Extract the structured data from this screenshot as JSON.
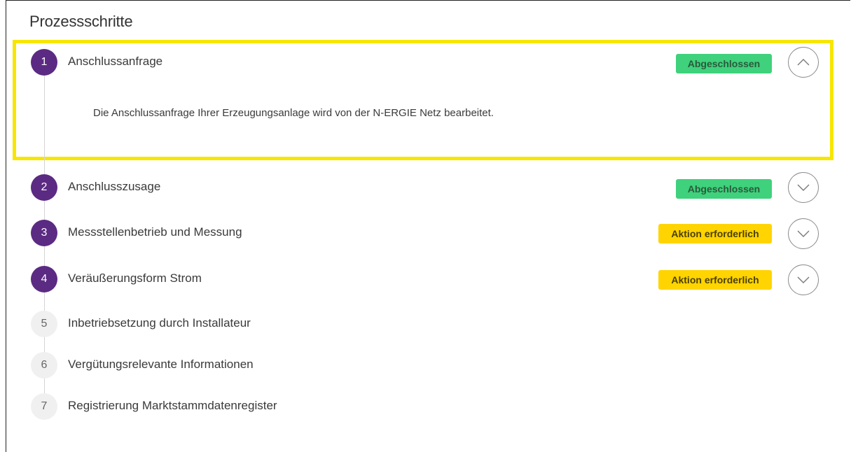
{
  "section": {
    "title": "Prozessschritte"
  },
  "steps": [
    {
      "number": "1",
      "label": "Anschlussanfrage",
      "status": "Abgeschlossen",
      "expanded": true,
      "description": "Die Anschlussanfrage Ihrer Erzeugungsanlage wird von der N-ERGIE Netz bearbeitet."
    },
    {
      "number": "2",
      "label": "Anschlusszusage",
      "status": "Abgeschlossen",
      "expanded": false
    },
    {
      "number": "3",
      "label": "Messstellenbetrieb und Messung",
      "status": "Aktion erforderlich",
      "expanded": false
    },
    {
      "number": "4",
      "label": "Veräußerungsform Strom",
      "status": "Aktion erforderlich",
      "expanded": false
    },
    {
      "number": "5",
      "label": "Inbetriebsetzung durch Installateur"
    },
    {
      "number": "6",
      "label": "Vergütungsrelevante Informationen"
    },
    {
      "number": "7",
      "label": "Registrierung Marktstammdatenregister"
    }
  ],
  "colors": {
    "active_step": "#5b2a82",
    "inactive_step": "#f0f0f0",
    "status_done": "#3fd17c",
    "status_action": "#ffd400",
    "highlight_border": "#f7e600"
  },
  "icons": {
    "expanded_toggle": "chevron-up-icon",
    "collapsed_toggle": "chevron-down-icon"
  }
}
